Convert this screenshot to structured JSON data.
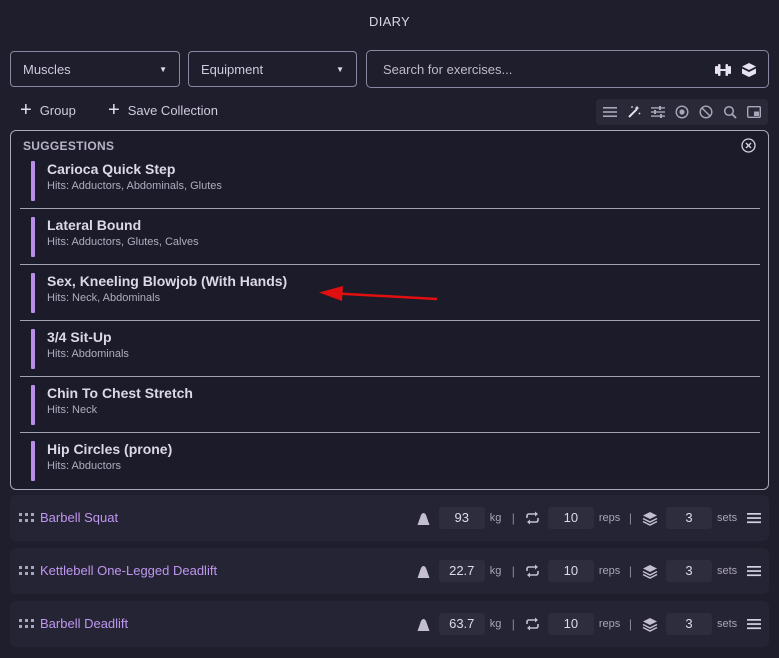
{
  "header": {
    "title": "DIARY"
  },
  "filters": {
    "muscles_label": "Muscles",
    "equipment_label": "Equipment",
    "search_placeholder": "Search for exercises..."
  },
  "toolbar": {
    "group_label": "Group",
    "save_collection_label": "Save Collection",
    "icons": [
      "list-icon",
      "magic-wand-icon",
      "sliders-icon",
      "target-icon",
      "block-icon",
      "search-icon",
      "picture-in-picture-icon"
    ]
  },
  "suggestions": {
    "heading": "SUGGESTIONS",
    "items": [
      {
        "name": "Carioca Quick Step",
        "hits": "Hits: Adductors, Abdominals, Glutes"
      },
      {
        "name": "Lateral Bound",
        "hits": "Hits: Adductors, Glutes, Calves"
      },
      {
        "name": "Sex, Kneeling Blowjob (With Hands)",
        "hits": "Hits: Neck, Abdominals"
      },
      {
        "name": "3/4 Sit-Up",
        "hits": "Hits: Abdominals"
      },
      {
        "name": "Chin To Chest Stretch",
        "hits": "Hits: Neck"
      },
      {
        "name": "Hip Circles (prone)",
        "hits": "Hits: Abductors"
      }
    ]
  },
  "exercises": [
    {
      "name": "Barbell Squat",
      "weight": "93",
      "weight_unit": "kg",
      "reps": "10",
      "reps_unit": "reps",
      "sets": "3",
      "sets_unit": "sets"
    },
    {
      "name": "Kettlebell One-Legged Deadlift",
      "weight": "22.7",
      "weight_unit": "kg",
      "reps": "10",
      "reps_unit": "reps",
      "sets": "3",
      "sets_unit": "sets"
    },
    {
      "name": "Barbell Deadlift",
      "weight": "63.7",
      "weight_unit": "kg",
      "reps": "10",
      "reps_unit": "reps",
      "sets": "3",
      "sets_unit": "sets"
    }
  ],
  "colors": {
    "accent": "#bf96ef",
    "suggestion_bar": "#b98ee8",
    "annotation_arrow": "#e01010"
  }
}
